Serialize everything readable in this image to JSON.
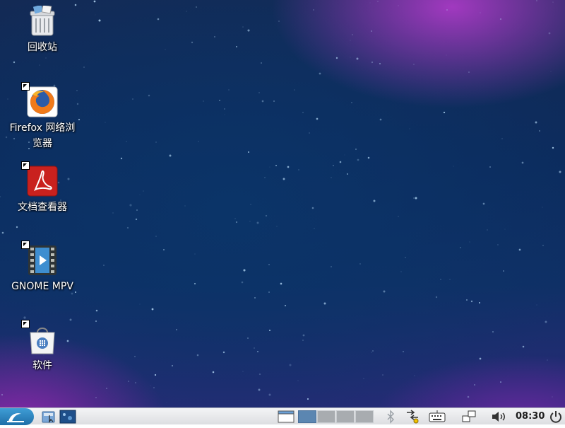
{
  "desktop": {
    "icons": [
      {
        "label": "回收站",
        "icon": "trash-icon"
      },
      {
        "label": "Firefox 网络浏览器",
        "icon": "firefox-icon"
      },
      {
        "label": "文档查看器",
        "icon": "pdf-viewer-icon"
      },
      {
        "label": "GNOME MPV",
        "icon": "video-player-icon"
      },
      {
        "label": "软件",
        "icon": "software-bag-icon"
      }
    ]
  },
  "taskbar": {
    "start_icon": "lubuntu-logo-icon",
    "launchers": [
      "file-manager-icon",
      "desktop-icon"
    ],
    "workspaces": {
      "count": 4,
      "active": 1
    },
    "tray_icons": [
      "window-list-icon",
      "bluetooth-icon",
      "network-icon",
      "keyboard-icon",
      "display-icon",
      "volume-icon",
      "power-icon"
    ],
    "clock": "08:30"
  },
  "colors": {
    "taskbar": "#e8eaec",
    "start": "#2a85c5",
    "workspace_active": "#5b86b1"
  }
}
